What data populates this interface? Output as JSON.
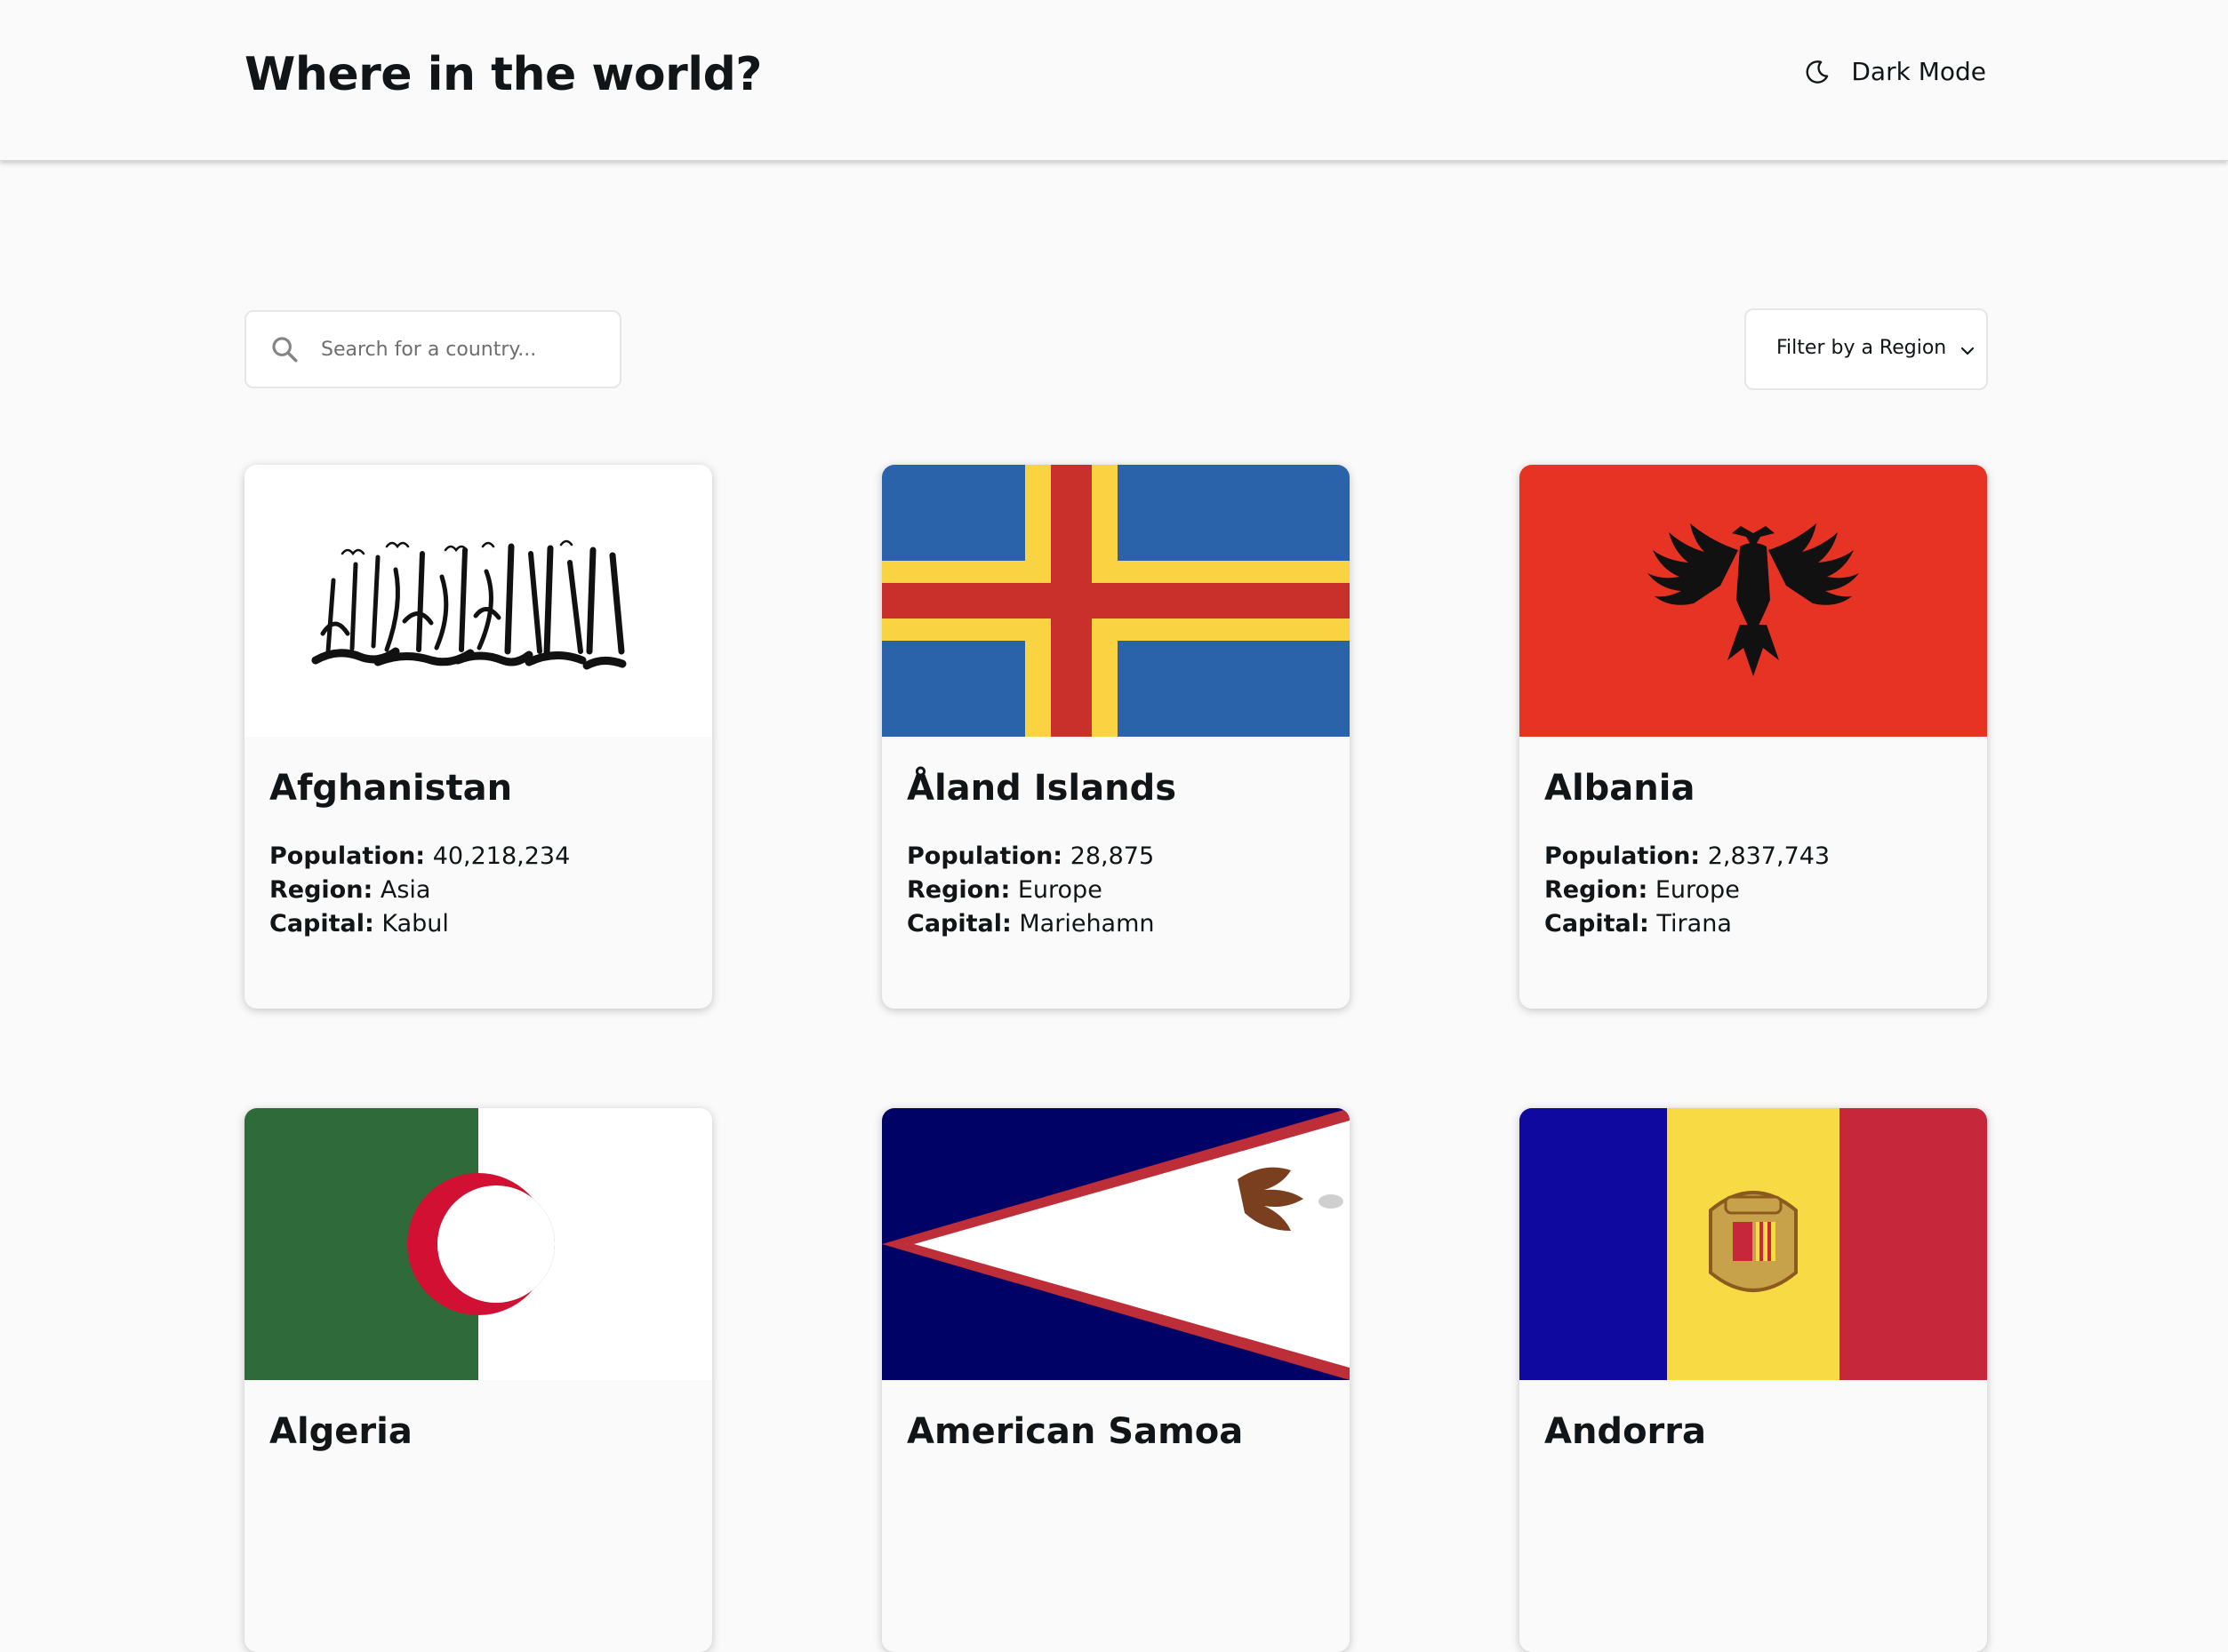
{
  "header": {
    "title": "Where in the world?",
    "dark_mode_label": "Dark Mode"
  },
  "search": {
    "placeholder": "Search for a country...",
    "value": ""
  },
  "filter": {
    "label": "Filter by a Region"
  },
  "labels": {
    "population": "Population:",
    "region": "Region:",
    "capital": "Capital:"
  },
  "countries": [
    {
      "name": "Afghanistan",
      "population": "40,218,234",
      "region": "Asia",
      "capital": "Kabul"
    },
    {
      "name": "Åland Islands",
      "population": "28,875",
      "region": "Europe",
      "capital": "Mariehamn"
    },
    {
      "name": "Albania",
      "population": "2,837,743",
      "region": "Europe",
      "capital": "Tirana"
    },
    {
      "name": "Algeria",
      "population": "",
      "region": "",
      "capital": ""
    },
    {
      "name": "American Samoa",
      "population": "",
      "region": "",
      "capital": ""
    },
    {
      "name": "Andorra",
      "population": "",
      "region": "",
      "capital": ""
    }
  ],
  "colors": {
    "background": "#fafafa",
    "text": "#111517",
    "aland_blue": "#2b63ab",
    "aland_yellow": "#f9d342",
    "aland_red": "#c9302c",
    "albania_red": "#e63323",
    "algeria_green": "#2f6b3a",
    "samoa_navy": "#000266",
    "samoa_red": "#bd2e38",
    "andorra_blue": "#1009a0",
    "andorra_yellow": "#f7da44",
    "andorra_red": "#c7273a"
  }
}
